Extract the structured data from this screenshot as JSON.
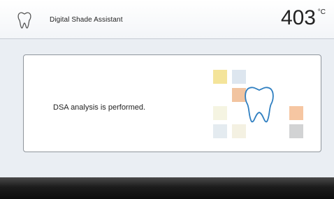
{
  "header": {
    "icon": "tooth-icon",
    "title": "Digital Shade Assistant",
    "temperature": "403",
    "temperature_unit": "°C"
  },
  "dialog": {
    "message": "DSA analysis is performed.",
    "illustration_icon": "tooth-icon",
    "swatch_colors": [
      "#f4e49a",
      "#dde6ef",
      "#f2c4a0",
      "#f5f4e2",
      "#f6c6a2",
      "#e4ebf0",
      "#f4f1e2",
      "#d2d3d4"
    ]
  },
  "colors": {
    "header_bg": "#ffffff",
    "content_bg": "#eaeef3",
    "icon_stroke": "#2f7fc1",
    "footer_bg": "#1c1c1c"
  }
}
